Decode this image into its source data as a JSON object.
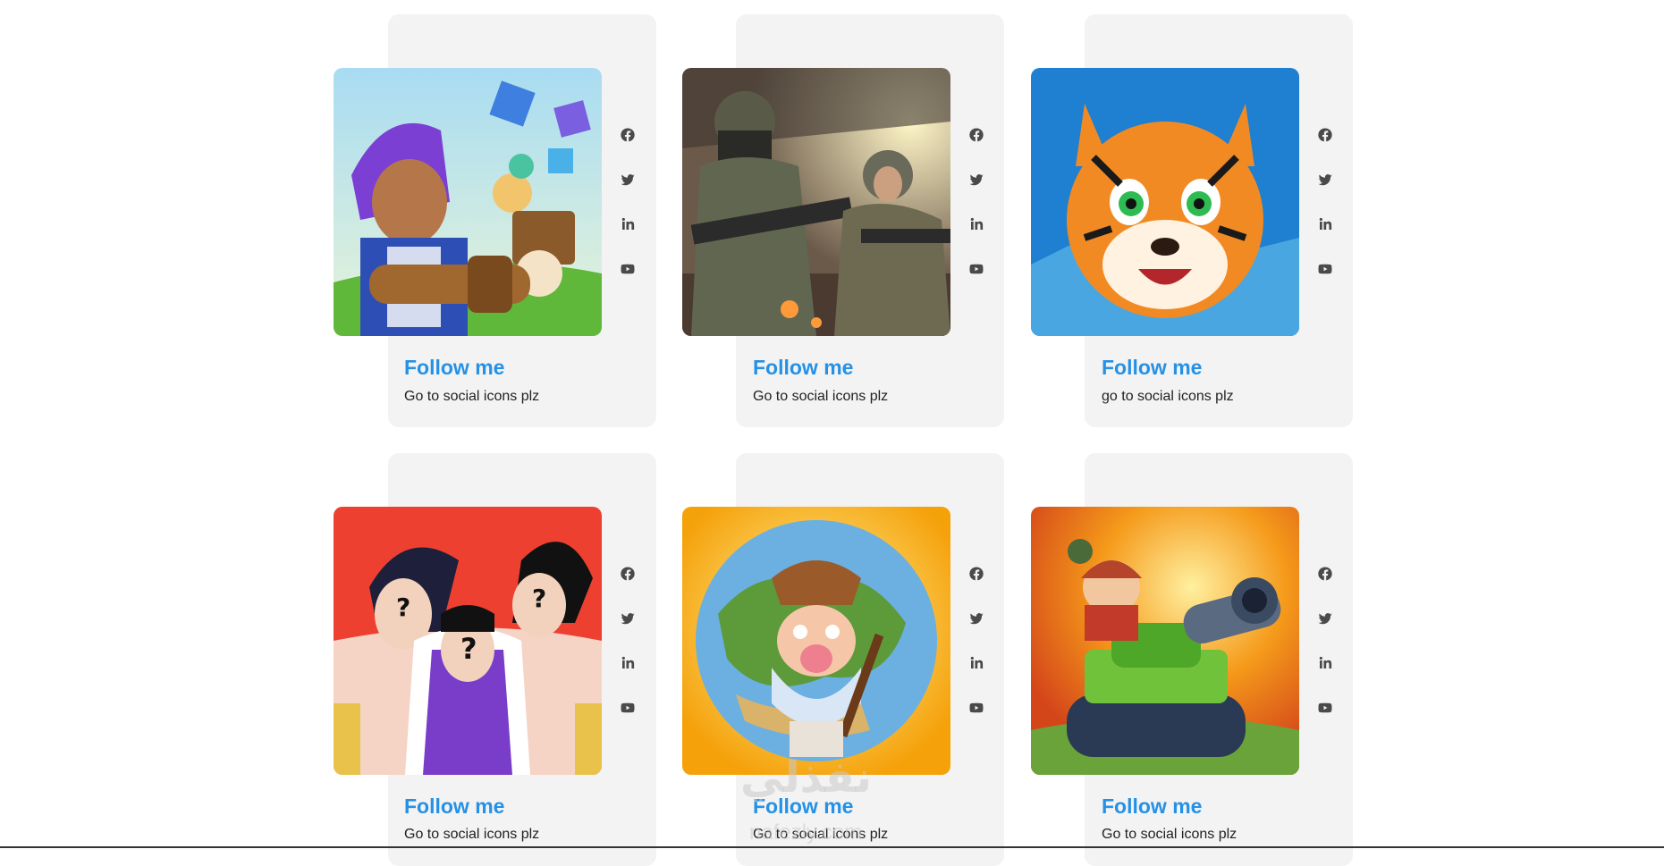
{
  "cards": [
    {
      "game": "blocky-shooter",
      "title": "Follow me",
      "subtitle": "Go to social icons plz"
    },
    {
      "game": "soldiers",
      "title": "Follow me",
      "subtitle": "Go to social icons plz"
    },
    {
      "game": "tiger",
      "title": "Follow me",
      "subtitle": "go to social icons plz"
    },
    {
      "game": "anime-silhouettes",
      "title": "Follow me",
      "subtitle": "Go to social icons plz"
    },
    {
      "game": "gold-miner",
      "title": "Follow me",
      "subtitle": "Go to social icons plz"
    },
    {
      "game": "tank",
      "title": "Follow me",
      "subtitle": "Go to social icons plz"
    }
  ],
  "social_icons": [
    "facebook-icon",
    "twitter-icon",
    "linkedin-icon",
    "youtube-icon"
  ],
  "watermark": {
    "text": "نفذلي",
    "sub": "nafezly.com"
  },
  "colors": {
    "accent": "#2591e6",
    "card_bg": "#f3f3f3",
    "icon": "#4a4a4a"
  }
}
